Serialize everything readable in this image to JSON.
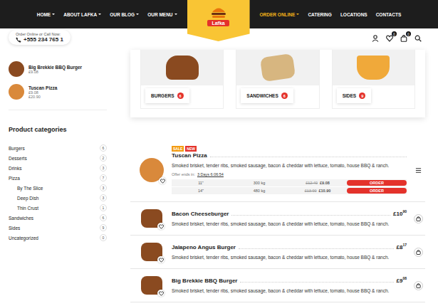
{
  "nav": {
    "left": [
      {
        "label": "HOME",
        "has_menu": true,
        "highlighted": false
      },
      {
        "label": "ABOUT LAFKA",
        "has_menu": true,
        "highlighted": false
      },
      {
        "label": "OUR BLOG",
        "has_menu": true,
        "highlighted": false
      },
      {
        "label": "OUR MENU",
        "has_menu": true,
        "highlighted": false
      }
    ],
    "right": [
      {
        "label": "ORDER ONLINE",
        "has_menu": true,
        "highlighted": true
      },
      {
        "label": "CATERING",
        "has_menu": false,
        "highlighted": false
      },
      {
        "label": "LOCATIONS",
        "has_menu": false,
        "highlighted": false
      },
      {
        "label": "CONTACTS",
        "has_menu": false,
        "highlighted": false
      }
    ]
  },
  "logo": {
    "text": "Lafka"
  },
  "contact": {
    "label": "Order Online or Call Now:",
    "phone": "+555 234 765 1"
  },
  "header_icons": {
    "wishlist_count": "0",
    "cart_count": "0"
  },
  "mini_cart": [
    {
      "name": "Big Brekkie BBQ Burger",
      "prices": [
        "£9.08"
      ]
    },
    {
      "name": "Tuscan Pizza",
      "prices": [
        "£9.08",
        "£20.90"
      ]
    }
  ],
  "categories": {
    "title": "Product categories",
    "items": [
      {
        "label": "Burgers",
        "count": "6",
        "sub": false
      },
      {
        "label": "Desserts",
        "count": "2",
        "sub": false
      },
      {
        "label": "Drinks",
        "count": "3",
        "sub": false
      },
      {
        "label": "Pizza",
        "count": "7",
        "sub": false
      },
      {
        "label": "By The Slice",
        "count": "3",
        "sub": true
      },
      {
        "label": "Deep Dish",
        "count": "3",
        "sub": true
      },
      {
        "label": "Thin Crust",
        "count": "1",
        "sub": true
      },
      {
        "label": "Sandwiches",
        "count": "6",
        "sub": false
      },
      {
        "label": "Sides",
        "count": "9",
        "sub": false
      },
      {
        "label": "Uncategorized",
        "count": "0",
        "sub": false
      }
    ]
  },
  "featured": [
    {
      "label": "BURGERS",
      "count": "6"
    },
    {
      "label": "SANDWICHES",
      "count": "6"
    },
    {
      "label": "SIDES",
      "count": "9"
    }
  ],
  "products": [
    {
      "name": "Tuscan Pizza",
      "kind": "variable",
      "badges": [
        {
          "label": "SALE",
          "color": "#f39c12"
        },
        {
          "label": "NEW",
          "color": "#e4322b"
        }
      ],
      "description": "Smoked brisket, tender ribs, smoked sausage, bacon & cheddar with lettuce, tomato, house BBQ & ranch.",
      "offer": {
        "label": "Offer ends in:",
        "time": "3 Days 6:06:54"
      },
      "variations": [
        {
          "size": "11\"",
          "weight": "300 kg",
          "old": "£12.40",
          "price": "£9.08",
          "button": "ORDER"
        },
        {
          "size": "14\"",
          "weight": "480 kg",
          "old": "£13.90",
          "price": "£10.90",
          "button": "ORDER"
        }
      ]
    },
    {
      "name": "Bacon Cheeseburger",
      "kind": "simple",
      "badges": [],
      "description": "Smoked brisket, tender ribs, smoked sausage, bacon & cheddar with lettuce, tomato, house BBQ & ranch.",
      "price": {
        "whole": "£10",
        "fraction": "90"
      }
    },
    {
      "name": "Jalapeno Angus Burger",
      "kind": "simple",
      "badges": [],
      "description": "Smoked brisket, tender ribs, smoked sausage, bacon & cheddar with lettuce, tomato, house BBQ & ranch.",
      "price": {
        "whole": "£8",
        "fraction": "17"
      }
    },
    {
      "name": "Big Brekkie BBQ Burger",
      "kind": "simple",
      "badges": [],
      "description": "Smoked brisket, tender ribs, smoked sausage, bacon & cheddar with lettuce, tomato, house BBQ & ranch.",
      "price": {
        "whole": "£9",
        "fraction": "08"
      }
    }
  ]
}
